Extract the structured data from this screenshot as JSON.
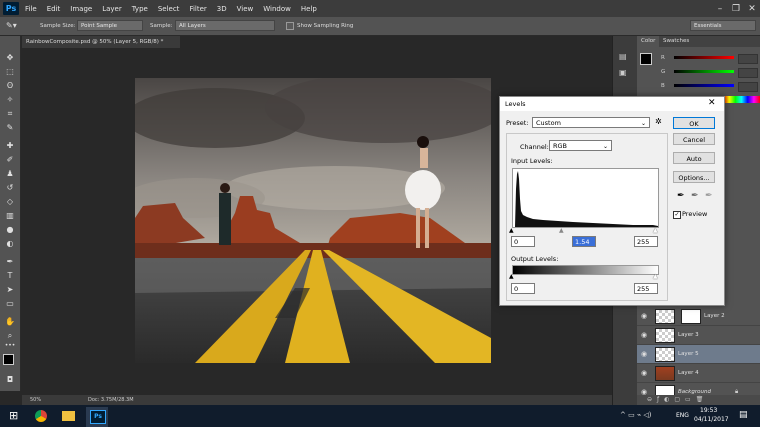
{
  "menubar": {
    "logo": "Ps",
    "items": [
      "File",
      "Edit",
      "Image",
      "Layer",
      "Type",
      "Select",
      "Filter",
      "3D",
      "View",
      "Window",
      "Help"
    ]
  },
  "options": {
    "sample_size_label": "Sample Size:",
    "sample_size_value": "Point Sample",
    "sample_label": "Sample:",
    "sample_value": "All Layers",
    "show_ring_label": "Show Sampling Ring",
    "workspace": "Essentials"
  },
  "document": {
    "tab_title": "RainbowComposite.psd @ 50% (Layer 5, RGB/8) *",
    "zoom": "50%",
    "doc_info": "Doc: 3.75M/28.3M"
  },
  "color_panel": {
    "tabs": [
      "Color",
      "Swatches"
    ],
    "channels": [
      "R",
      "G",
      "B"
    ]
  },
  "layers": [
    {
      "name": "Layer 2"
    },
    {
      "name": "Layer 3"
    },
    {
      "name": "Layer 5"
    },
    {
      "name": "Layer 4"
    },
    {
      "name": "Background"
    }
  ],
  "levels_dialog": {
    "title": "Levels",
    "preset_label": "Preset:",
    "preset_value": "Custom",
    "channel_label": "Channel:",
    "channel_value": "RGB",
    "input_levels_label": "Input Levels:",
    "input_black": "0",
    "input_gamma": "1.54",
    "input_white": "255",
    "output_levels_label": "Output Levels:",
    "output_black": "0",
    "output_white": "255",
    "ok": "OK",
    "cancel": "Cancel",
    "auto": "Auto",
    "options": "Options...",
    "preview_label": "Preview"
  },
  "taskbar": {
    "language": "ENG",
    "time": "19:53",
    "date": "04/11/2017"
  }
}
